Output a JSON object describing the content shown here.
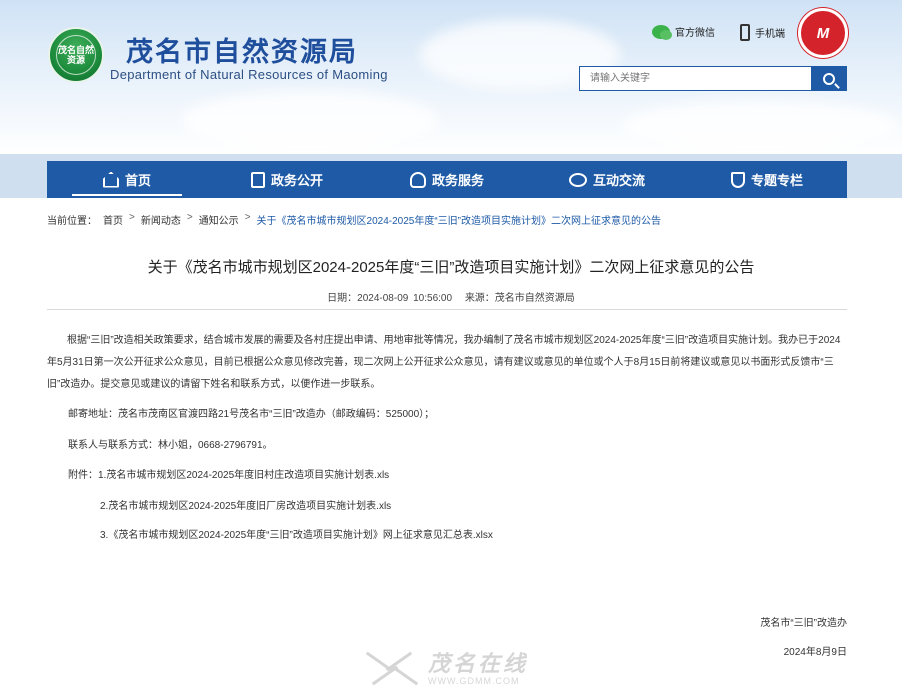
{
  "header": {
    "logo_text": "茂名自然资源",
    "title": "茂名市自然资源局",
    "subtitle": "Department of Natural Resources of Maoming",
    "wechat_label": "官方微信",
    "mobile_label": "手机端",
    "emblem_text": "M",
    "search": {
      "placeholder": "请输入关键字"
    }
  },
  "nav": {
    "items": [
      {
        "label": "首页",
        "icon": "home-icon"
      },
      {
        "label": "政务公开",
        "icon": "document-icon"
      },
      {
        "label": "政务服务",
        "icon": "user-service-icon"
      },
      {
        "label": "互动交流",
        "icon": "chat-icon"
      },
      {
        "label": "专题专栏",
        "icon": "trophy-icon"
      }
    ]
  },
  "breadcrumb": {
    "prefix": "当前位置：",
    "items": [
      "首页",
      "新闻动态",
      "通知公示"
    ],
    "current": "关于《茂名市城市规划区2024-2025年度“三旧”改造项目实施计划》二次网上征求意见的公告",
    "sep": ">"
  },
  "article": {
    "title": "关于《茂名市城市规划区2024-2025年度“三旧”改造项目实施计划》二次网上征求意见的公告",
    "date": "日期：2024-08-09 10:56:00",
    "source": "来源：茂名市自然资源局",
    "body": "根据“三旧”改造相关政策要求，结合城市发展的需要及各村庄提出申请、用地审批等情况，我办编制了茂名市城市规划区2024-2025年度“三旧”改造项目实施计划。我办已于2024年5月31日第一次公开征求公众意见，目前已根据公众意见修改完善，现二次网上公开征求公众意见，请有建议或意见的单位或个人于8月15日前将建议或意见以书面形式反馈市“三旧”改造办。提交意见或建议的请留下姓名和联系方式，以便作进一步联系。",
    "address": "邮寄地址：茂名市茂南区官渡四路21号茂名市“三旧”改造办（邮政编码：525000）；",
    "contact": "联系人与联系方式：林小姐，0668-2796791。",
    "attachments": [
      "附件：1.茂名市城市规划区2024-2025年度旧村庄改造项目实施计划表.xls",
      "2.茂名市城市规划区2024-2025年度旧厂房改造项目实施计划表.xls",
      "3.《茂名市城市规划区2024-2025年度“三旧”改造项目实施计划》网上征求意见汇总表.xlsx"
    ],
    "signer": "茂名市“三旧”改造办",
    "sign_date": "2024年8月9日"
  },
  "watermark": {
    "big": "茂名在线",
    "small": "WWW.GDMM.COM"
  }
}
